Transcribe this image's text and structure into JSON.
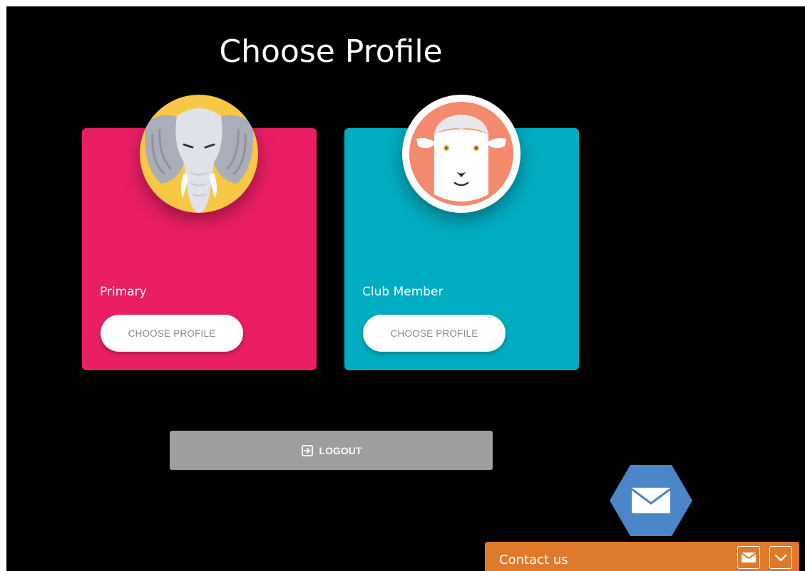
{
  "page": {
    "title": "Choose Profile"
  },
  "profiles": [
    {
      "label": "Primary",
      "button_label": "CHOOSE PROFILE",
      "avatar": "elephant-avatar",
      "card_color": "#e91e63"
    },
    {
      "label": "Club Member",
      "button_label": "CHOOSE PROFILE",
      "avatar": "sheep-avatar",
      "card_color": "#00acc1"
    }
  ],
  "logout": {
    "label": "LOGOUT",
    "icon": "logout-icon"
  },
  "contact": {
    "label": "Contact us",
    "icons": [
      "mail-icon",
      "chevron-down-icon"
    ],
    "accent": "#e07a2b"
  },
  "floating_mail": {
    "icon": "mail-icon",
    "color": "#4a86c8"
  }
}
